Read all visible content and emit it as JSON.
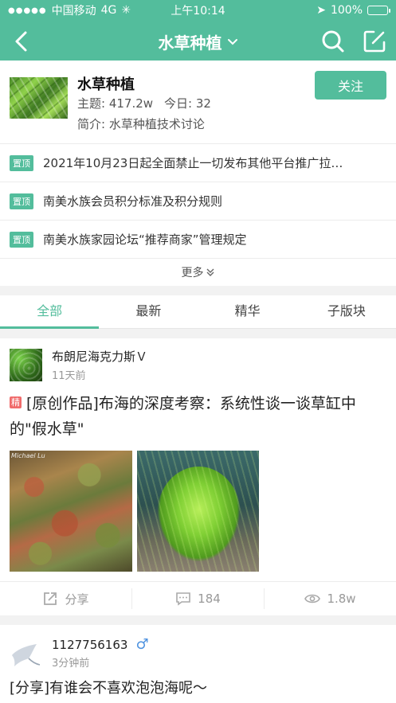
{
  "status_bar": {
    "carrier": "中国移动",
    "network": "4G",
    "time": "上午10:14",
    "battery": "100%"
  },
  "nav": {
    "title": "水草种植",
    "icons": [
      "back-icon",
      "chevron-down-icon",
      "search-icon",
      "edit-icon"
    ]
  },
  "forum": {
    "name": "水草种植",
    "topics_label": "主题: 417.2w",
    "today_label": "今日: 32",
    "intro": "简介: 水草种植技术讨论",
    "follow_label": "关注"
  },
  "pinned": {
    "tag": "置顶",
    "items": [
      "2021年10月23日起全面禁止一切发布其他平台推广拉…",
      "南美水族会员积分标准及积分规则",
      "南美水族家园论坛“推荐商家”管理规定"
    ],
    "more_label": "更多"
  },
  "tabs": [
    "全部",
    "最新",
    "精华",
    "子版块"
  ],
  "posts": [
    {
      "author": "布朗尼海克力斯Ｖ",
      "time": "11天前",
      "badge": "精",
      "title": "[原创作品]布海的深度考察：系统性谈一谈草缸中的\"假水草\"",
      "watermark": "Michael Lu",
      "share_label": "分享",
      "comments": "184",
      "views": "1.8w"
    },
    {
      "author": "1127756163",
      "gender_symbol": "♂",
      "time": "3分钟前",
      "title": "[分享]有谁会不喜欢泡泡海呢～"
    }
  ],
  "colors": {
    "accent": "#53bd9c",
    "badge_red": "#f06b6b",
    "male_blue": "#4f93e0"
  }
}
